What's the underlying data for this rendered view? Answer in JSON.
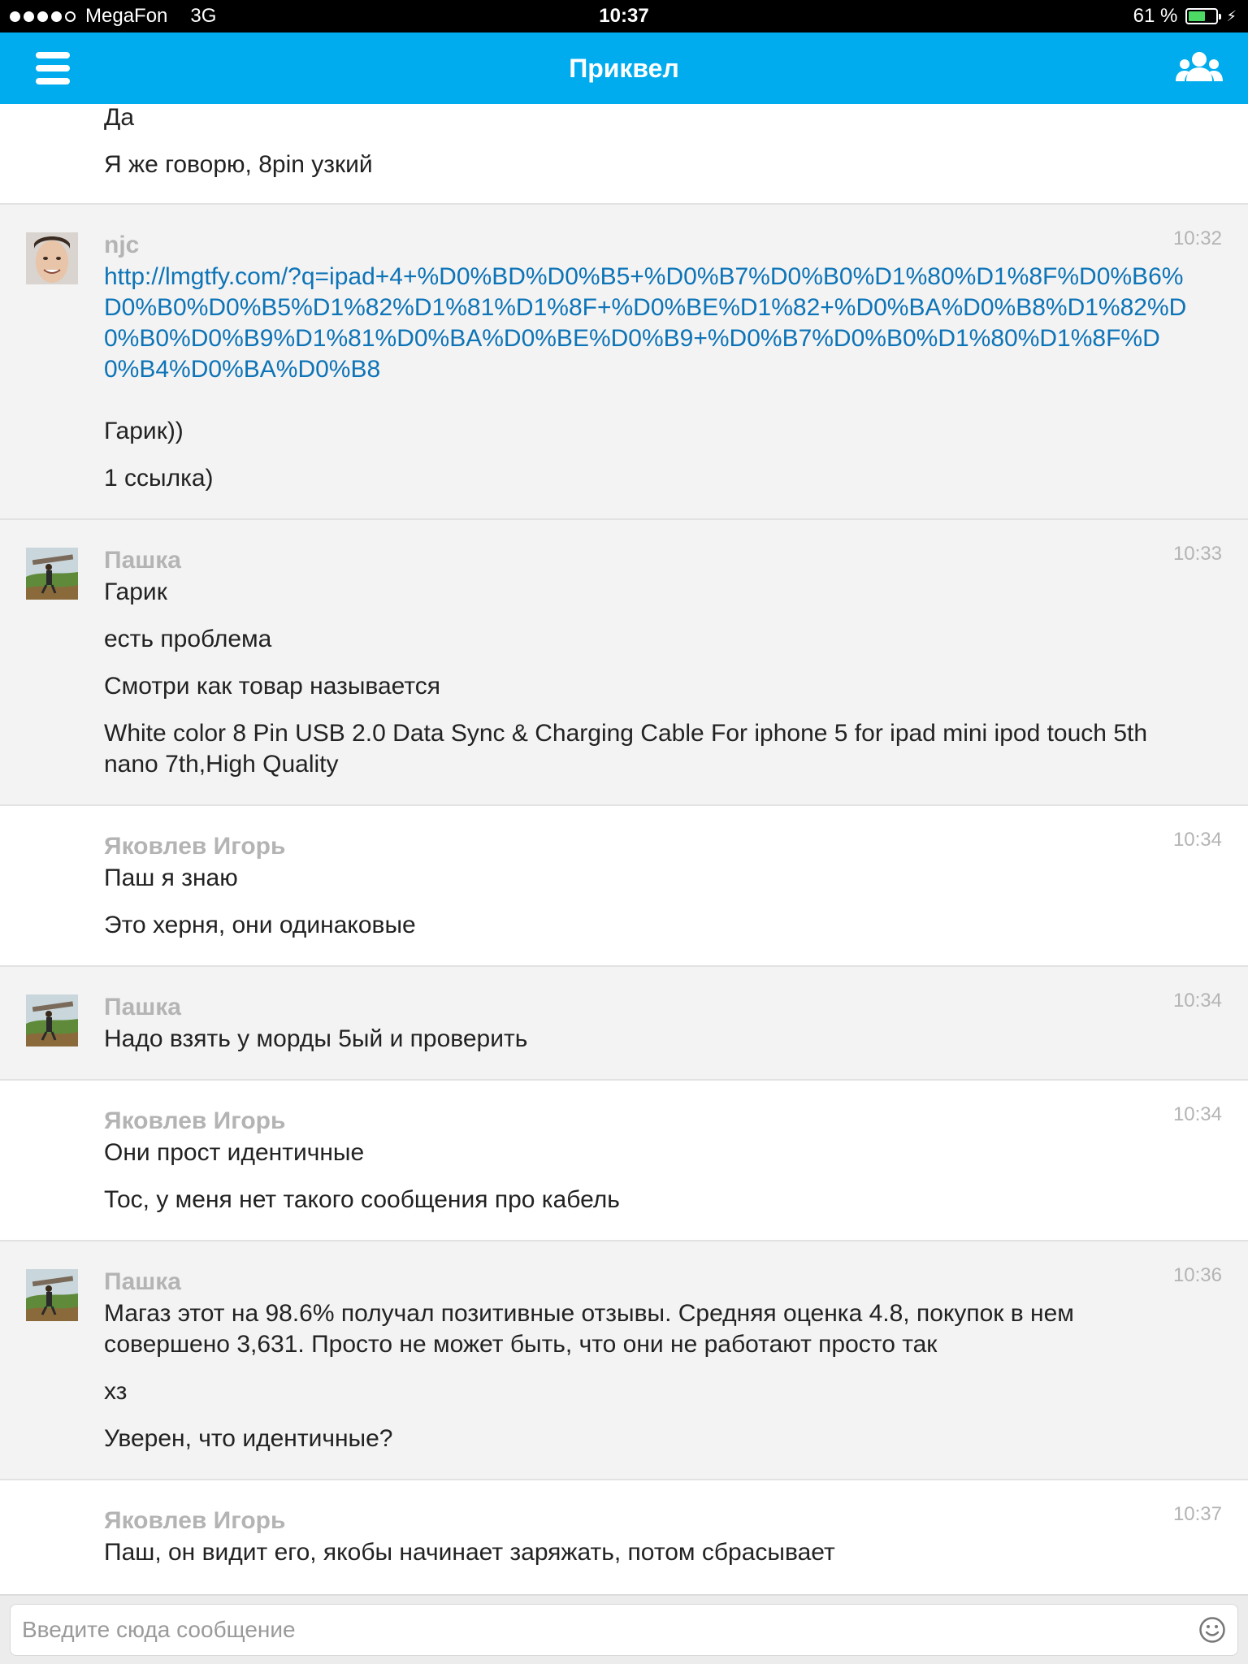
{
  "status_bar": {
    "carrier": "MegaFon",
    "network": "3G",
    "time": "10:37",
    "battery_text": "61 %",
    "battery_level": 0.61,
    "signal_bars_filled": 4,
    "signal_bars_total": 5
  },
  "nav": {
    "title": "Приквел"
  },
  "messages": [
    {
      "sender": "",
      "time": "",
      "lines": [
        "Да",
        "Я же говорю, 8pin узкий"
      ]
    },
    {
      "sender": "njc",
      "time": "10:32",
      "link": "http://lmgtfy.com/?q=ipad+4+%D0%BD%D0%B5+%D0%B7%D0%B0%D1%80%D1%8F%D0%B6%D0%B0%D0%B5%D1%82%D1%81%D1%8F+%D0%BE%D1%82+%D0%BA%D0%B8%D1%82%D0%B0%D0%B9%D1%81%D0%BA%D0%BE%D0%B9+%D0%B7%D0%B0%D1%80%D1%8F%D0%B4%D0%BA%D0%B8",
      "lines": [
        "Гарик))",
        "1 ссылка)"
      ]
    },
    {
      "sender": "Пашка",
      "time": "10:33",
      "lines": [
        "Гарик",
        "есть проблема",
        "Смотри как товар называется",
        "White color 8 Pin USB 2.0 Data Sync & Charging Cable For iphone 5 for ipad mini ipod touch 5th nano 7th,High Quality"
      ]
    },
    {
      "sender": "Яковлев Игорь",
      "time": "10:34",
      "lines": [
        "Паш я знаю",
        "Это херня, они одинаковые"
      ]
    },
    {
      "sender": "Пашка",
      "time": "10:34",
      "lines": [
        "Надо взять у морды 5ый и проверить"
      ]
    },
    {
      "sender": "Яковлев Игорь",
      "time": "10:34",
      "lines": [
        "Они прост идентичные",
        "Тос, у меня нет такого сообщения про кабель"
      ]
    },
    {
      "sender": "Пашка",
      "time": "10:36",
      "lines": [
        "Магаз этот на 98.6% получал позитивные отзывы. Средняя оценка 4.8, покупок в нем совершено 3,631. Просто не может быть, что они не работают просто так",
        "хз",
        "Уверен, что идентичные?"
      ]
    },
    {
      "sender": "Яковлев Игорь",
      "time": "10:37",
      "lines": [
        "Паш, он видит его, якобы начинает заряжать, потом сбрасывает"
      ]
    }
  ],
  "composer": {
    "placeholder": "Введите сюда сообщение"
  },
  "colors": {
    "accent": "#00aced",
    "link": "#0d74b7",
    "meta": "#b4b4b4"
  },
  "icons": {
    "menu": "hamburger-icon",
    "group": "people-icon",
    "emoji": "smiley-icon"
  }
}
